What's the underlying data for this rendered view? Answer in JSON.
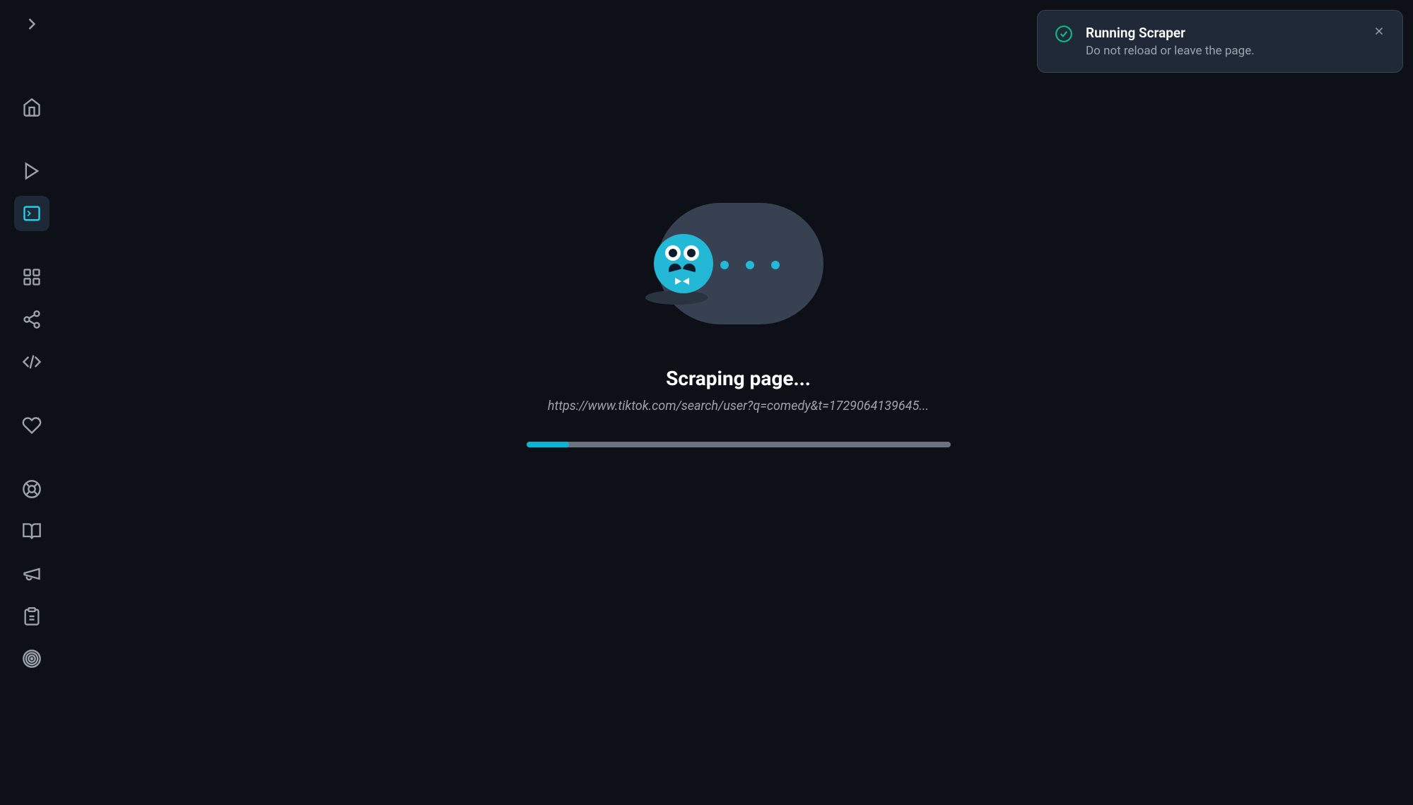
{
  "sidebar": {
    "items": [
      {
        "name": "home",
        "icon": "home-icon"
      },
      {
        "name": "play",
        "icon": "play-icon"
      },
      {
        "name": "terminal",
        "icon": "terminal-icon",
        "active": true
      },
      {
        "name": "apps",
        "icon": "grid-icon"
      },
      {
        "name": "share",
        "icon": "share-icon"
      },
      {
        "name": "code",
        "icon": "code-icon"
      },
      {
        "name": "favorites",
        "icon": "heart-icon"
      },
      {
        "name": "help",
        "icon": "lifebuoy-icon"
      },
      {
        "name": "docs",
        "icon": "book-icon"
      },
      {
        "name": "announce",
        "icon": "megaphone-icon"
      },
      {
        "name": "clipboard",
        "icon": "clipboard-icon"
      },
      {
        "name": "status",
        "icon": "signal-icon"
      }
    ]
  },
  "main": {
    "title": "Scraping page...",
    "url": "https://www.tiktok.com/search/user?q=comedy&t=1729064139645...",
    "progress_percent": 10
  },
  "toast": {
    "title": "Running Scraper",
    "description": "Do not reload or leave the page.",
    "status": "success"
  }
}
